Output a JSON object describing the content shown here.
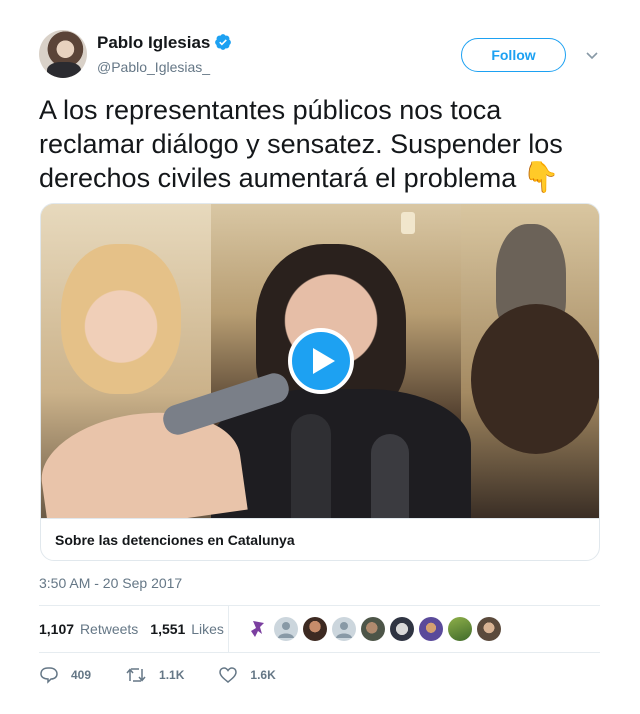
{
  "user": {
    "name": "Pablo Iglesias",
    "handle": "@Pablo_Iglesias_",
    "verified": true
  },
  "follow_label": "Follow",
  "tweet": {
    "text": "A los representantes públicos nos toca reclamar diálogo y sensatez. Suspender los derechos civiles aumentará el problema",
    "emoji": "👇",
    "timestamp": "3:50 AM - 20 Sep 2017"
  },
  "media": {
    "caption": "Sobre las detenciones en Catalunya"
  },
  "stats": {
    "retweets_count": "1,107",
    "retweets_label": "Retweets",
    "likes_count": "1,551",
    "likes_label": "Likes"
  },
  "actions": {
    "replies": "409",
    "retweets": "1.1K",
    "likes": "1.6K"
  },
  "colors": {
    "accent": "#1da1f2",
    "muted": "#657786",
    "text": "#14171a"
  }
}
